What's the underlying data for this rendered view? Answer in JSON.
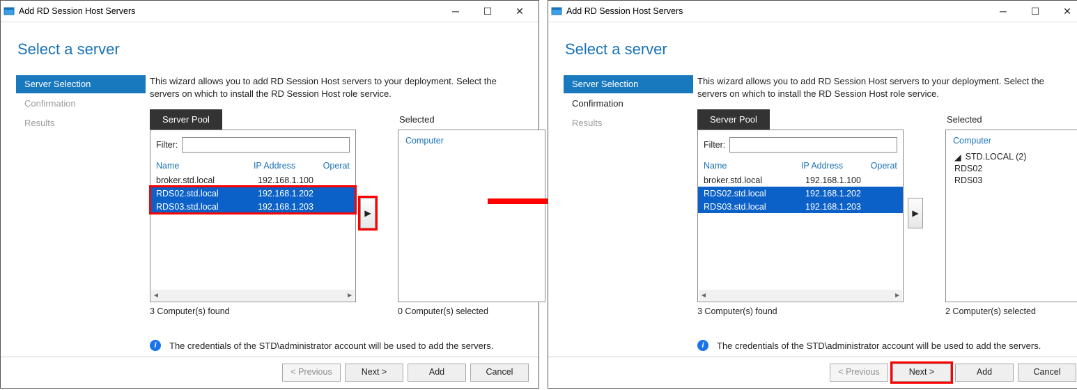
{
  "window_title": "Add RD Session Host Servers",
  "heading": "Select a server",
  "sidebar": {
    "items": [
      {
        "label": "Server Selection"
      },
      {
        "label": "Confirmation"
      },
      {
        "label": "Results"
      }
    ]
  },
  "intro": "This wizard allows you to add RD Session Host servers to your deployment. Select the servers on which to install the RD Session Host role service.",
  "pool": {
    "tab": "Server Pool",
    "filter_label": "Filter:",
    "filter_value": "",
    "cols": {
      "name": "Name",
      "ip": "IP Address",
      "os": "Operat"
    },
    "rows": [
      {
        "name": "broker.std.local",
        "ip": "192.168.1.100",
        "selected": false
      },
      {
        "name": "RDS02.std.local",
        "ip": "192.168.1.202",
        "selected": true
      },
      {
        "name": "RDS03.std.local",
        "ip": "192.168.1.203",
        "selected": true
      }
    ],
    "count_label": "3 Computer(s) found"
  },
  "selected_panel": {
    "title": "Selected",
    "header": "Computer",
    "left_count": "0 Computer(s) selected",
    "right_count": "2 Computer(s) selected",
    "right_domain": "STD.LOCAL (2)",
    "right_nodes": [
      "RDS02",
      "RDS03"
    ]
  },
  "info_text": "The credentials of the STD\\administrator account will be used to add the servers.",
  "footer": {
    "previous": "< Previous",
    "next": "Next >",
    "add": "Add",
    "cancel": "Cancel"
  }
}
